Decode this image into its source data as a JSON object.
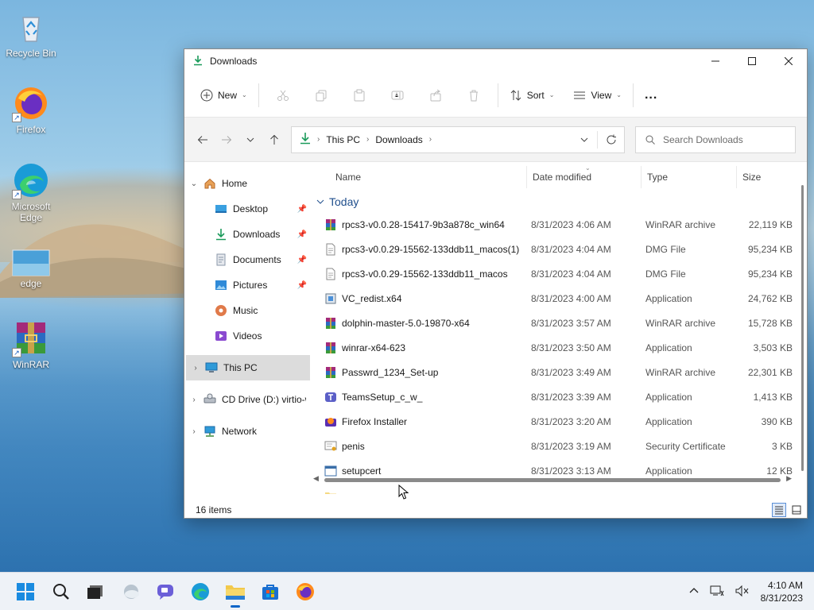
{
  "desktop": {
    "icons": [
      {
        "label": "Recycle Bin"
      },
      {
        "label": "Firefox"
      },
      {
        "label": "Microsoft Edge"
      },
      {
        "label": "edge"
      },
      {
        "label": "WinRAR"
      }
    ]
  },
  "window": {
    "title": "Downloads",
    "toolbar": {
      "new_label": "New",
      "sort_label": "Sort",
      "view_label": "View",
      "more_label": "..."
    },
    "address": {
      "crumbs": [
        "This PC",
        "Downloads"
      ]
    },
    "search": {
      "placeholder": "Search Downloads"
    },
    "nav": {
      "items": [
        {
          "label": "Home"
        },
        {
          "label": "Desktop"
        },
        {
          "label": "Downloads"
        },
        {
          "label": "Documents"
        },
        {
          "label": "Pictures"
        },
        {
          "label": "Music"
        },
        {
          "label": "Videos"
        },
        {
          "label": "This PC"
        },
        {
          "label": "CD Drive (D:) virtio-w"
        },
        {
          "label": "Network"
        }
      ]
    },
    "columns": {
      "name": "Name",
      "date": "Date modified",
      "type": "Type",
      "size": "Size"
    },
    "group_label": "Today",
    "files": [
      {
        "name": "rpcs3-v0.0.28-15417-9b3a878c_win64",
        "date": "8/31/2023 4:06 AM",
        "type": "WinRAR archive",
        "size": "22,119 KB",
        "icon": "winrar-icon"
      },
      {
        "name": "rpcs3-v0.0.29-15562-133ddb11_macos(1)",
        "date": "8/31/2023 4:04 AM",
        "type": "DMG File",
        "size": "95,234 KB",
        "icon": "generic-file-icon"
      },
      {
        "name": "rpcs3-v0.0.29-15562-133ddb11_macos",
        "date": "8/31/2023 4:04 AM",
        "type": "DMG File",
        "size": "95,234 KB",
        "icon": "generic-file-icon"
      },
      {
        "name": "VC_redist.x64",
        "date": "8/31/2023 4:00 AM",
        "type": "Application",
        "size": "24,762 KB",
        "icon": "installer-icon"
      },
      {
        "name": "dolphin-master-5.0-19870-x64",
        "date": "8/31/2023 3:57 AM",
        "type": "WinRAR archive",
        "size": "15,728 KB",
        "icon": "winrar-icon"
      },
      {
        "name": "winrar-x64-623",
        "date": "8/31/2023 3:50 AM",
        "type": "Application",
        "size": "3,503 KB",
        "icon": "winrar-icon"
      },
      {
        "name": "Passwrd_1234_Set-up",
        "date": "8/31/2023 3:49 AM",
        "type": "WinRAR archive",
        "size": "22,301 KB",
        "icon": "winrar-icon"
      },
      {
        "name": "TeamsSetup_c_w_",
        "date": "8/31/2023 3:39 AM",
        "type": "Application",
        "size": "1,413 KB",
        "icon": "teams-icon"
      },
      {
        "name": "Firefox Installer",
        "date": "8/31/2023 3:20 AM",
        "type": "Application",
        "size": "390 KB",
        "icon": "firefox-installer-icon"
      },
      {
        "name": "penis",
        "date": "8/31/2023 3:19 AM",
        "type": "Security Certificate",
        "size": "3 KB",
        "icon": "certificate-icon"
      },
      {
        "name": "setupcert",
        "date": "8/31/2023 3:13 AM",
        "type": "Application",
        "size": "12 KB",
        "icon": "application-icon"
      }
    ],
    "status": {
      "item_count": "16 items"
    }
  },
  "taskbar": {
    "time": "4:10 AM",
    "date": "8/31/2023"
  },
  "colors": {
    "accent": "#0a64c8",
    "group_header": "#1f4e8c",
    "selected_nav": "#dcdcdc"
  }
}
